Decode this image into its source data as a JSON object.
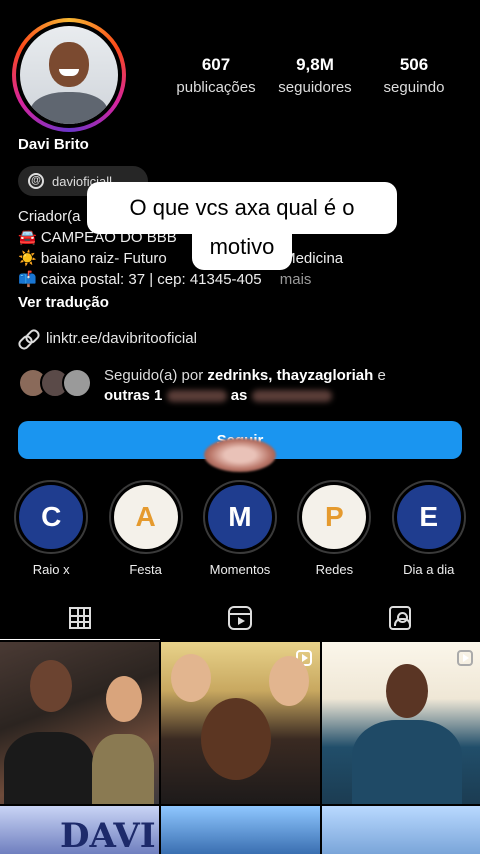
{
  "profile": {
    "name": "Davi Brito",
    "stats": [
      {
        "value": "607",
        "label": "publicações"
      },
      {
        "value": "9,8M",
        "label": "seguidores"
      },
      {
        "value": "506",
        "label": "seguindo"
      }
    ],
    "threads_handle": "davioficiall",
    "bio": {
      "category": "Criador(a",
      "line1": "🚘 CAMPEÃO DO BBB",
      "line2": "☀️ baiano raiz- Futuro",
      "line2_end": "Medicina",
      "line3": "📫 caixa postal: 37 | cep: 41345-405",
      "more": "mais",
      "translate": "Ver tradução"
    },
    "link": "linktr.ee/davibritooficial",
    "followed_by": {
      "prefix": "Seguido(a) por",
      "names": "zedrinks, thayzagloriah",
      "suffix": "e",
      "line2_start": "outras 1",
      "line2_end": "as"
    },
    "follow_button": "Seguir"
  },
  "caption": {
    "line1": "O que vcs axa qual é o",
    "line2": "motivo"
  },
  "highlights": [
    {
      "letter": "C",
      "label": "Raio x",
      "bg": "#1f3d8f",
      "fg": "#ffffff"
    },
    {
      "letter": "A",
      "label": "Festa",
      "bg": "#f4f1ea",
      "fg": "#e59a2e"
    },
    {
      "letter": "M",
      "label": "Momentos",
      "bg": "#1f3d8f",
      "fg": "#ffffff"
    },
    {
      "letter": "P",
      "label": "Redes",
      "bg": "#f4f1ea",
      "fg": "#e59a2e"
    },
    {
      "letter": "E",
      "label": "Dia a dia",
      "bg": "#1f3d8f",
      "fg": "#ffffff"
    }
  ],
  "tabs": [
    "grid-icon",
    "reels-icon",
    "tagged-icon"
  ],
  "grid_text": {
    "davi_banner": "DAVI"
  },
  "colors": {
    "accent": "#1a95f0",
    "background": "#000000"
  }
}
